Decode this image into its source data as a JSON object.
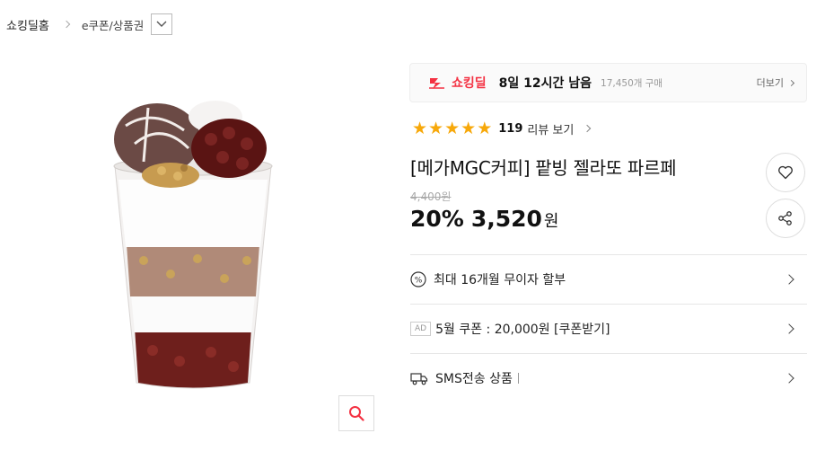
{
  "breadcrumb": {
    "home": "쇼킹딜홈",
    "category": "e쿠폰/상품권"
  },
  "deal": {
    "brand": "쇼킹딜",
    "time_left": "8일 12시간 남음",
    "purchases": "17,450개 구매",
    "more": "더보기",
    "accent_color": "#f43142"
  },
  "rating": {
    "stars": 5,
    "review_count": "119",
    "review_link": "리뷰 보기",
    "star_color": "#f7a80a"
  },
  "product": {
    "title": "[메가MGC커피] 팥빙 젤라또 파르페",
    "original_price": "4,400원",
    "discount": "20%",
    "price": "3,520",
    "currency": "원"
  },
  "rows": {
    "installment": "최대 16개월 무이자 할부",
    "ad_tag": "AD",
    "coupon": "5월 쿠폰 : 20,000원 [쿠폰받기]",
    "sms": "SMS전송 상품"
  },
  "icons": {
    "breadcrumb_dropdown": "chevron-down-icon",
    "zoom": "magnifier-icon",
    "like": "heart-icon",
    "share": "share-icon",
    "installment": "percent-icon",
    "sms": "truck-icon"
  }
}
